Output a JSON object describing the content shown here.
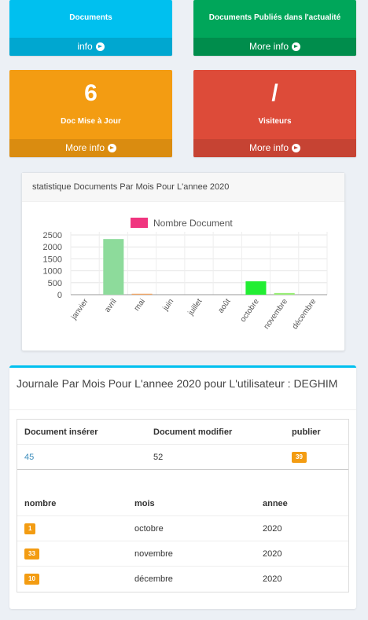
{
  "boxes": {
    "documents": {
      "number": "",
      "label": "Documents",
      "footer": "info",
      "color": "#00c0ef"
    },
    "published": {
      "number": "",
      "label": "Documents Publiés dans l'actualité",
      "footer": "More info",
      "color": "#00a65a"
    },
    "updated": {
      "number": "6",
      "label": "Doc Mise à Jour",
      "footer": "More info",
      "color": "#f39c12"
    },
    "visitors": {
      "number": "/",
      "label": "Visiteurs",
      "footer": "More info",
      "color": "#dd4b39"
    }
  },
  "chart_box": {
    "title": "statistique Documents Par Mois Pour L'annee 2020"
  },
  "chart_data": {
    "type": "bar",
    "title": "",
    "categories": [
      "janvier",
      "avril",
      "mai",
      "juin",
      "juillet",
      "août",
      "octobre",
      "novembre",
      "décembre"
    ],
    "series": [
      {
        "name": "Nombre Document",
        "values": [
          0,
          2330,
          40,
          0,
          0,
          0,
          560,
          70,
          0
        ]
      }
    ],
    "bar_colors": [
      "#9be3a8",
      "#8ddb9b",
      "#f4a460",
      "#cccccc",
      "#cccccc",
      "#cccccc",
      "#22ee33",
      "#99ee77",
      "#cccccc"
    ],
    "legend_color": "#f0357f",
    "yticks": [
      "2500",
      "2000",
      "1500",
      "1000",
      "500",
      "0"
    ],
    "ylim": [
      0,
      2500
    ],
    "grid": true,
    "legend": "top"
  },
  "journal": {
    "title": "Journale Par Mois Pour L'annee 2020 pour L'utilisateur : DEGHIM",
    "summary_headers": [
      "Document insérer",
      "Document modifier",
      "publier"
    ],
    "summary_values": {
      "inserted": "45",
      "modified": "52",
      "published": "39"
    },
    "detail_headers": [
      "nombre",
      "mois",
      "annee"
    ],
    "detail_rows": [
      {
        "count": "1",
        "month": "octobre",
        "year": "2020"
      },
      {
        "count": "33",
        "month": "novembre",
        "year": "2020"
      },
      {
        "count": "10",
        "month": "décembre",
        "year": "2020"
      }
    ]
  }
}
